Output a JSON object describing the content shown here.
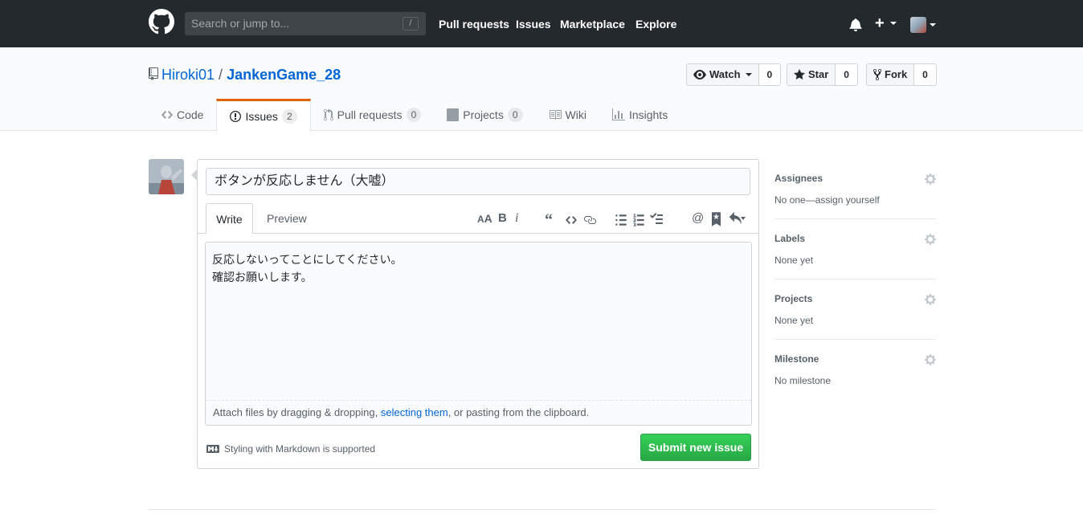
{
  "header": {
    "search_placeholder": "Search or jump to...",
    "search_shortcut": "/",
    "nav": [
      "Pull requests",
      "Issues",
      "Marketplace",
      "Explore"
    ]
  },
  "repo": {
    "owner": "Hiroki01",
    "separator": "/",
    "name": "JankenGame_28",
    "watch_label": "Watch",
    "watch_count": "0",
    "star_label": "Star",
    "star_count": "0",
    "fork_label": "Fork",
    "fork_count": "0"
  },
  "tabs": [
    {
      "label": "Code",
      "count": null
    },
    {
      "label": "Issues",
      "count": "2"
    },
    {
      "label": "Pull requests",
      "count": "0"
    },
    {
      "label": "Projects",
      "count": "0"
    },
    {
      "label": "Wiki",
      "count": null
    },
    {
      "label": "Insights",
      "count": null
    }
  ],
  "issue_form": {
    "title_value": "ボタンが反応しません（大嘘）",
    "write_tab": "Write",
    "preview_tab": "Preview",
    "body_value": "反応しないってことにしてください。\n確認お願いします。",
    "attach_prefix": "Attach files by dragging & dropping, ",
    "attach_link": "selecting them",
    "attach_suffix": ", or pasting from the clipboard.",
    "markdown_note": "Styling with Markdown is supported",
    "submit_label": "Submit new issue"
  },
  "sidebar": [
    {
      "heading": "Assignees",
      "value": "No one—assign yourself"
    },
    {
      "heading": "Labels",
      "value": "None yet"
    },
    {
      "heading": "Projects",
      "value": "None yet"
    },
    {
      "heading": "Milestone",
      "value": "No milestone"
    }
  ],
  "colors": {
    "header_bg": "#24292e",
    "link": "#0366d6",
    "selected_tab_accent": "#e36209",
    "submit_green": "#28a745"
  }
}
